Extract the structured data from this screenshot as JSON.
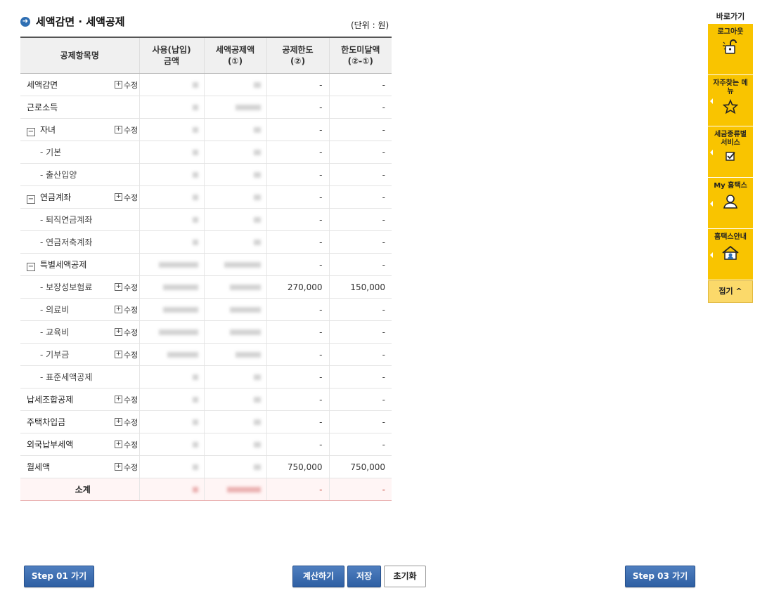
{
  "page_title": "세액감면 · 세액공제",
  "unit_label": "(단위 : 원)",
  "table": {
    "headers": {
      "item": "공제항목명",
      "usage_line1": "사용(납입)",
      "usage_line2": "금액",
      "amount_line1": "세액공제액",
      "amount_line2": "(①)",
      "limit_line1": "공제한도",
      "limit_line2": "(②)",
      "remain_line1": "한도미달액",
      "remain_line2": "(②-①)"
    },
    "edit_label": "수정",
    "rows": [
      {
        "name": "세액감면",
        "level": 0,
        "toggle": false,
        "edit": true,
        "limit": "-",
        "remain": "-",
        "w1": 8,
        "w2": 10
      },
      {
        "name": "근로소득",
        "level": 0,
        "toggle": false,
        "edit": false,
        "limit": "-",
        "remain": "-",
        "w1": 8,
        "w2": 36
      },
      {
        "name": "자녀",
        "level": 1,
        "toggle": true,
        "edit": true,
        "limit": "-",
        "remain": "-",
        "w1": 8,
        "w2": 10
      },
      {
        "name": "- 기본",
        "level": 2,
        "toggle": false,
        "edit": false,
        "limit": "-",
        "remain": "-",
        "w1": 8,
        "w2": 10
      },
      {
        "name": "- 출산입양",
        "level": 2,
        "toggle": false,
        "edit": false,
        "limit": "-",
        "remain": "-",
        "w1": 8,
        "w2": 10
      },
      {
        "name": "연금계좌",
        "level": 1,
        "toggle": true,
        "edit": true,
        "limit": "-",
        "remain": "-",
        "w1": 8,
        "w2": 10
      },
      {
        "name": "- 퇴직연금계좌",
        "level": 2,
        "toggle": false,
        "edit": false,
        "limit": "-",
        "remain": "-",
        "w1": 8,
        "w2": 10
      },
      {
        "name": "- 연금저축계좌",
        "level": 2,
        "toggle": false,
        "edit": false,
        "limit": "-",
        "remain": "-",
        "w1": 8,
        "w2": 10
      },
      {
        "name": "특별세액공제",
        "level": 1,
        "toggle": true,
        "edit": false,
        "limit": "-",
        "remain": "-",
        "w1": 56,
        "w2": 52
      },
      {
        "name": "- 보장성보험료",
        "level": 2,
        "toggle": false,
        "edit": true,
        "limit": "270,000",
        "remain": "150,000",
        "w1": 50,
        "w2": 44
      },
      {
        "name": "- 의료비",
        "level": 2,
        "toggle": false,
        "edit": true,
        "limit": "-",
        "remain": "-",
        "w1": 50,
        "w2": 44
      },
      {
        "name": "- 교육비",
        "level": 2,
        "toggle": false,
        "edit": true,
        "limit": "-",
        "remain": "-",
        "w1": 56,
        "w2": 44
      },
      {
        "name": "- 기부금",
        "level": 2,
        "toggle": false,
        "edit": true,
        "limit": "-",
        "remain": "-",
        "w1": 44,
        "w2": 36
      },
      {
        "name": "- 표준세액공제",
        "level": 2,
        "toggle": false,
        "edit": false,
        "limit": "-",
        "remain": "-",
        "w1": 8,
        "w2": 10
      },
      {
        "name": "납세조합공제",
        "level": 0,
        "toggle": false,
        "edit": true,
        "limit": "-",
        "remain": "-",
        "w1": 8,
        "w2": 10
      },
      {
        "name": "주택차입금",
        "level": 0,
        "toggle": false,
        "edit": true,
        "limit": "-",
        "remain": "-",
        "w1": 8,
        "w2": 10
      },
      {
        "name": "외국납부세액",
        "level": 0,
        "toggle": false,
        "edit": true,
        "limit": "-",
        "remain": "-",
        "w1": 8,
        "w2": 10
      },
      {
        "name": "월세액",
        "level": 0,
        "toggle": false,
        "edit": true,
        "limit": "750,000",
        "remain": "750,000",
        "w1": 8,
        "w2": 10
      }
    ],
    "subtotal": {
      "name": "소계",
      "limit": "-",
      "remain": "-",
      "w1": 8,
      "w2": 48
    }
  },
  "buttons": {
    "step01": "Step 01 가기",
    "calculate": "계산하기",
    "save": "저장",
    "reset": "초기화",
    "step03": "Step 03 가기"
  },
  "quicknav": {
    "title": "바로가기",
    "items": [
      {
        "label": "로그아웃",
        "icon": "unlock-icon"
      },
      {
        "label": "자주찾는 메뉴",
        "icon": "star-icon"
      },
      {
        "label": "세금종류별 서비스",
        "icon": "checkbox-icon"
      },
      {
        "label": "My 홈택스",
        "icon": "user-icon"
      },
      {
        "label": "홈택스안내",
        "icon": "home-guide-icon"
      }
    ],
    "fold": "접기 ^"
  }
}
